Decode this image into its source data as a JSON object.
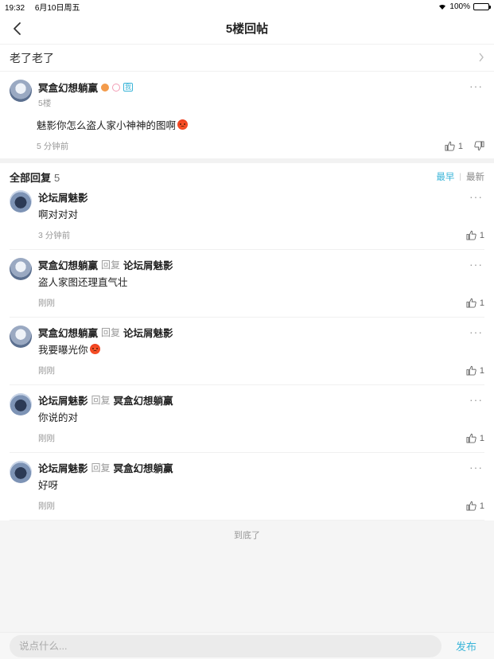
{
  "status_bar": {
    "time": "19:32",
    "date": "6月10日周五",
    "battery": "100%"
  },
  "nav": {
    "title": "5楼回帖"
  },
  "thread": {
    "title": "老了老了"
  },
  "floor": {
    "author": "冥盒幻想躺赢",
    "me_tag": "我",
    "floor_label": "5楼",
    "content": "魅影你怎么盗人家小神神的图啊",
    "time": "5 分钟前",
    "likes": "1"
  },
  "replies": {
    "label": "全部回复",
    "count": "5",
    "sort_early": "最早",
    "sort_new": "最新",
    "reply_word": "回复",
    "items": [
      {
        "author": "论坛屑魅影",
        "target": "",
        "text": "啊对对对",
        "time": "3 分钟前",
        "likes": "1",
        "emoji": false
      },
      {
        "author": "冥盒幻想躺赢",
        "target": "论坛屑魅影",
        "text": "盗人家图还理直气壮",
        "time": "刚刚",
        "likes": "1",
        "emoji": false
      },
      {
        "author": "冥盒幻想躺赢",
        "target": "论坛屑魅影",
        "text": "我要曝光你",
        "time": "刚刚",
        "likes": "1",
        "emoji": true
      },
      {
        "author": "论坛屑魅影",
        "target": "冥盒幻想躺赢",
        "text": "你说的对",
        "time": "刚刚",
        "likes": "1",
        "emoji": false
      },
      {
        "author": "论坛屑魅影",
        "target": "冥盒幻想躺赢",
        "text": "好呀",
        "time": "刚刚",
        "likes": "1",
        "emoji": false
      }
    ]
  },
  "end_text": "到底了",
  "composer": {
    "placeholder": "说点什么...",
    "send_label": "发布"
  },
  "colors": {
    "accent": "#3bb5d8"
  }
}
